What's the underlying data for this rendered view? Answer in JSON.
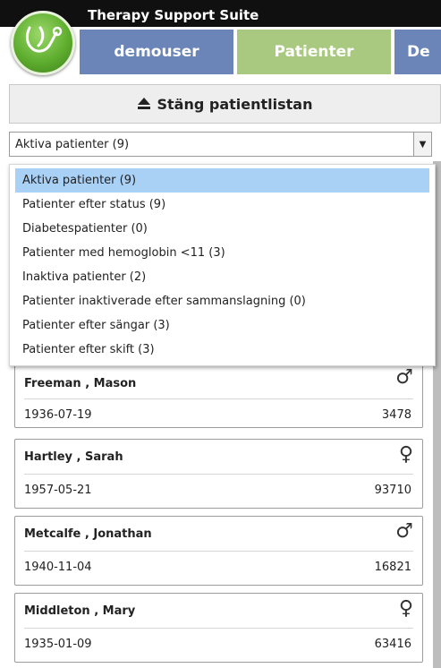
{
  "header": {
    "app_title": "Therapy Support Suite",
    "tabs": [
      {
        "label": "demouser"
      },
      {
        "label": "Patienter"
      },
      {
        "label": "De"
      }
    ]
  },
  "close_list": {
    "icon": "eject-icon",
    "label": "Stäng patientlistan"
  },
  "filter_select": {
    "selected": "Aktiva patienter (9)",
    "options": [
      "Aktiva patienter (9)",
      "Patienter efter status (9)",
      "Diabetespatienter (0)",
      "Patienter med hemoglobin <11 (3)",
      "Inaktiva patienter (2)",
      "Patienter inaktiverade efter sammanslagning (0)",
      "Patienter efter sängar (3)",
      "Patienter efter skift (3)"
    ]
  },
  "patients": [
    {
      "name": "Freeman , Mason",
      "sex_symbol": "♂",
      "dob": "1936-07-19",
      "id": "3478"
    },
    {
      "name": "Hartley , Sarah",
      "sex_symbol": "♀",
      "dob": "1957-05-21",
      "id": "93710"
    },
    {
      "name": "Metcalfe , Jonathan",
      "sex_symbol": "♂",
      "dob": "1940-11-04",
      "id": "16821"
    },
    {
      "name": "Middleton , Mary",
      "sex_symbol": "♀",
      "dob": "1935-01-09",
      "id": "63416"
    }
  ],
  "colors": {
    "tab_user": "#6b85b8",
    "tab_active": "#a8c97f",
    "selected_option": "#a9d0f5",
    "logo_green": "#5fae2f"
  }
}
